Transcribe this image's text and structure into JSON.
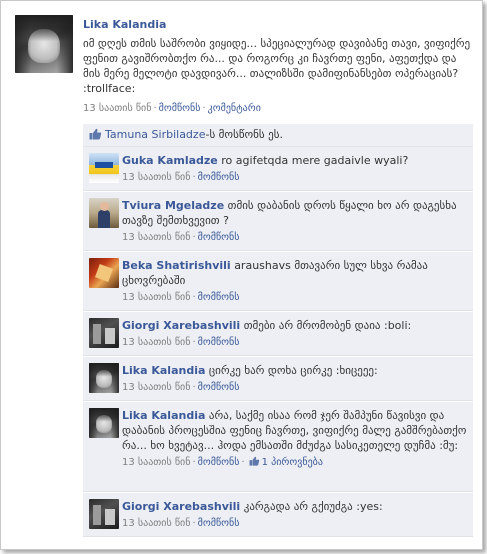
{
  "post": {
    "author": "Lika Kalandia",
    "text": "იმ დღეს თმის საშრობი ვიყიდე... სპეციალურად დავიბანე თავი, ვიფიქრე ფენით გავიშრობთქო რა... და როგორც კი ჩავრთე ფენი, აფეთქდა და მის მერე მელოტი დავდივარ... თალიზსში დამიფინანსებთ ოპერაციას? :trollface:",
    "time": "13 საათის წინ",
    "like_label": "მომწონს",
    "comment_label": "კომენტარი"
  },
  "likes": {
    "liker": "Tamuna Sirbiladze",
    "suffix": "-ს მოსწონს ეს."
  },
  "comments": [
    {
      "author": "Guka Kamladze",
      "text": "ro agifetqda mere gadaivle wyali?",
      "time": "13 საათის წინ",
      "like_label": "მომწონს"
    },
    {
      "author": "Tviura Mgeladze",
      "text": "თმის დაბანის დროს წყალი ხო არ დაგესხა თავზე შემთხვევით ?",
      "time": "13 საათის წინ",
      "like_label": "მომწონს"
    },
    {
      "author": "Beka Shatirishvili",
      "text": "araushavs მთავარი სულ სხვა რამაა ცხოვრებაში",
      "time": "13 საათის წინ",
      "like_label": "მომწონს"
    },
    {
      "author": "Giorgi Xarebashvili",
      "text": "თმები არ მრომობენ დაია :boli:",
      "time": "13 საათის წინ",
      "like_label": "მომწონს"
    },
    {
      "author": "Lika Kalandia",
      "text": "ცირკე ხარ დოხა ცირკე :ხიცეეე:",
      "time": "13 საათის წინ",
      "like_label": "მომწონს"
    },
    {
      "author": "Lika Kalandia",
      "text": "არა, საქმე ისაა რომ ჯერ შამპუნი წავისვი და დაბანის პროცესშია ფენიც ჩავრთე, ვიფიქრე მალე გამშრებათქო რა... ხო ხვეტავ... ჰოდა ემსათში მძუძგა სასიკეთელე დუჩმა :მუ:",
      "time": "13 საათის წინ",
      "like_label": "მომწონს",
      "likes_count": "1 პიროვნება"
    },
    {
      "author": "Giorgi Xarebashvili",
      "text": "კარგადა არ გქიუძგა :yes:",
      "time": "13 საათის წინ",
      "like_label": "მომწონს"
    }
  ],
  "separator": "·",
  "colors": {
    "link": "#3b5998",
    "meta": "#808080",
    "comment_bg": "#edeff4"
  }
}
